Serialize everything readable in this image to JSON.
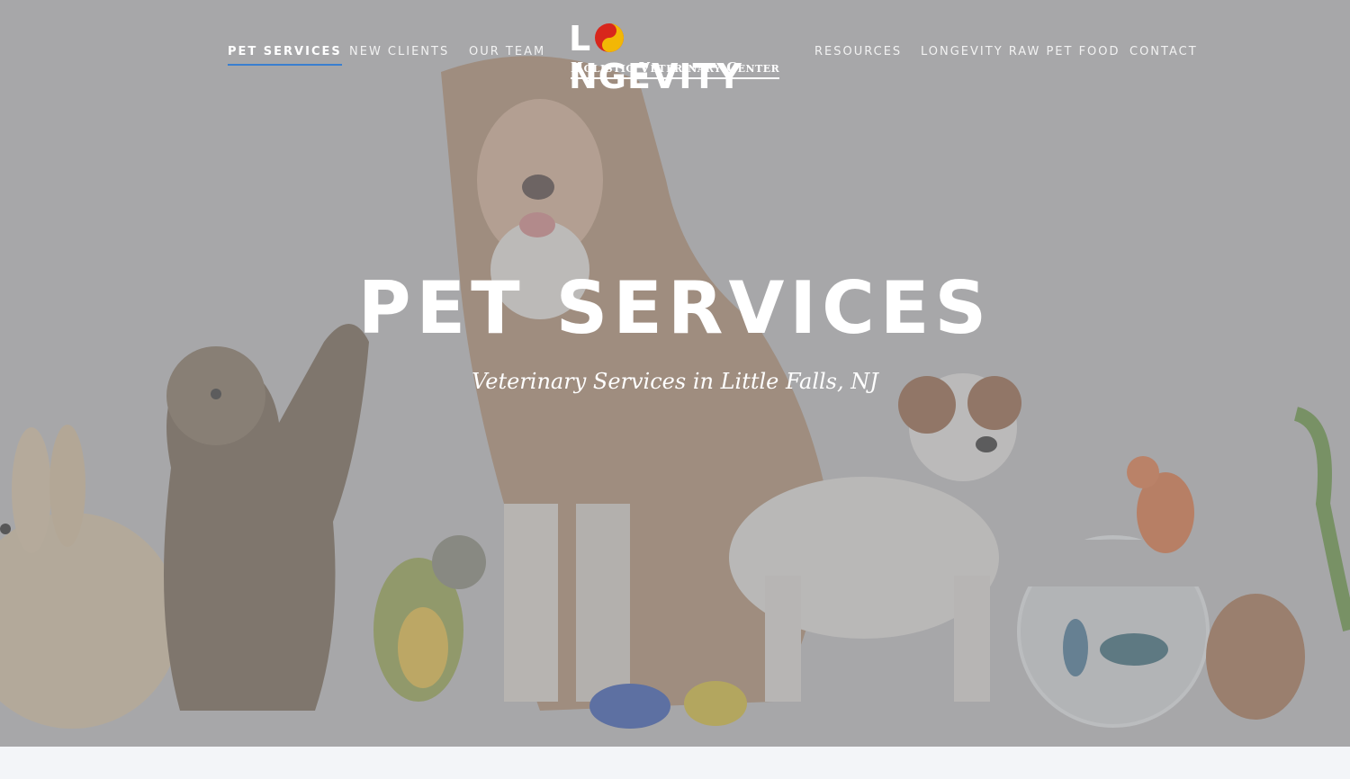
{
  "nav": {
    "left": [
      "PET SERVICES",
      "NEW CLIENTS",
      "OUR TEAM"
    ],
    "right": [
      "RESOURCES",
      "LONGEVITY RAW PET FOOD",
      "CONTACT"
    ],
    "active": "PET SERVICES"
  },
  "logo": {
    "word_first": "L",
    "word_rest": "NGEVITY",
    "subtitle": "Holistic Veterinary Center",
    "icon": "yin-yang-paw-icon"
  },
  "hero": {
    "title": "PET SERVICES",
    "subtitle": "Veterinary Services in Little Falls, NJ",
    "overlay_color": "#9a9a9c"
  },
  "colors": {
    "accent": "#3a7fd0",
    "logo_red": "#d8261c",
    "logo_yellow": "#f2b705"
  }
}
